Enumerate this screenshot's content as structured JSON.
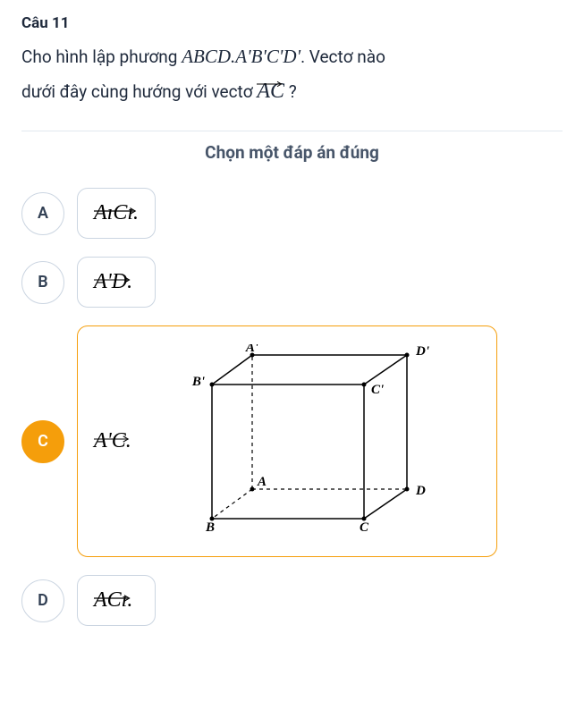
{
  "question": {
    "number": "Câu 11",
    "text_part1": "Cho hình lập phương ",
    "math_cube": "ABCD.A'B'C'D'",
    "text_part2": ". Vectơ nào",
    "text_part3": "dưới đây cùng hướng với vectơ ",
    "vector_ref": "AC",
    "text_part4": " ?"
  },
  "instruction": "Chọn một đáp án đúng",
  "options": {
    "a": {
      "letter": "A",
      "vector_text": "AıCı."
    },
    "b": {
      "letter": "B",
      "vector_text": "A'D."
    },
    "c": {
      "letter": "C",
      "vector_text": "A'C."
    },
    "d": {
      "letter": "D",
      "vector_text": "ACı."
    }
  },
  "cube": {
    "labels": {
      "A_prime": "A'",
      "B_prime": "B'",
      "C_prime": "C'",
      "D_prime": "D'",
      "A": "A",
      "B": "B",
      "C": "C",
      "D": "D"
    }
  }
}
